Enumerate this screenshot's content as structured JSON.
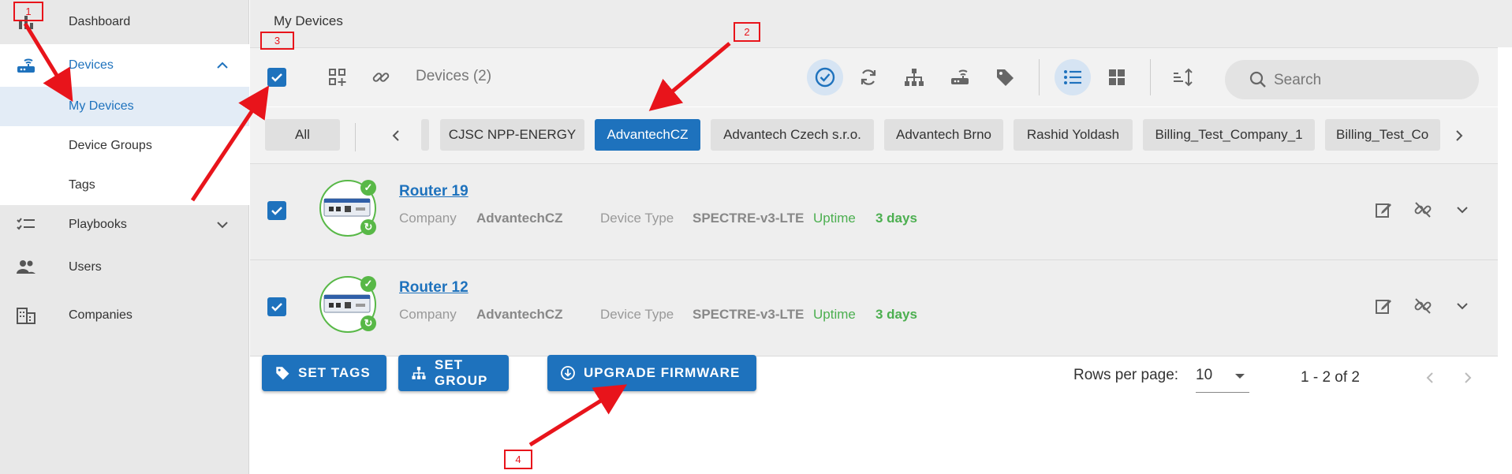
{
  "sidebar": {
    "items": [
      {
        "label": "Dashboard",
        "icon": "bar-chart-icon"
      },
      {
        "label": "Devices",
        "icon": "router-icon",
        "active": true
      },
      {
        "label": "Playbooks",
        "icon": "checklist-icon"
      },
      {
        "label": "Users",
        "icon": "people-icon"
      },
      {
        "label": "Companies",
        "icon": "building-icon"
      }
    ],
    "sub_items": [
      {
        "label": "My Devices",
        "active": true
      },
      {
        "label": "Device Groups"
      },
      {
        "label": "Tags"
      }
    ]
  },
  "header": {
    "title": "My Devices"
  },
  "toolbar": {
    "devices_count": "Devices (2)",
    "search_placeholder": "Search"
  },
  "companies": {
    "all_label": "All",
    "chips": [
      "CJSC NPP-ENERGY",
      "AdvantechCZ",
      "Advantech Czech s.r.o.",
      "Advantech Brno",
      "Rashid Yoldash",
      "Billing_Test_Company_1",
      "Billing_Test_Co"
    ],
    "selected": "AdvantechCZ"
  },
  "devices": [
    {
      "name": "Router 19",
      "company_label": "Company",
      "company": "AdvantechCZ",
      "type_label": "Device Type",
      "type": "SPECTRE-v3-LTE",
      "uptime_label": "Uptime",
      "uptime": "3 days",
      "checked": true
    },
    {
      "name": "Router 12",
      "company_label": "Company",
      "company": "AdvantechCZ",
      "type_label": "Device Type",
      "type": "SPECTRE-v3-LTE",
      "uptime_label": "Uptime",
      "uptime": "3 days",
      "checked": true
    }
  ],
  "actions": {
    "set_tags": "SET TAGS",
    "set_group": "SET GROUP",
    "upgrade_firmware": "UPGRADE FIRMWARE"
  },
  "pagination": {
    "rows_per_page_label": "Rows per page:",
    "rows_per_page": "10",
    "range": "1 - 2 of 2"
  },
  "annotations": [
    "1",
    "2",
    "3",
    "4"
  ],
  "colors": {
    "accent": "#1e72bd",
    "success": "#4caf50",
    "annotation": "#e8141b"
  }
}
